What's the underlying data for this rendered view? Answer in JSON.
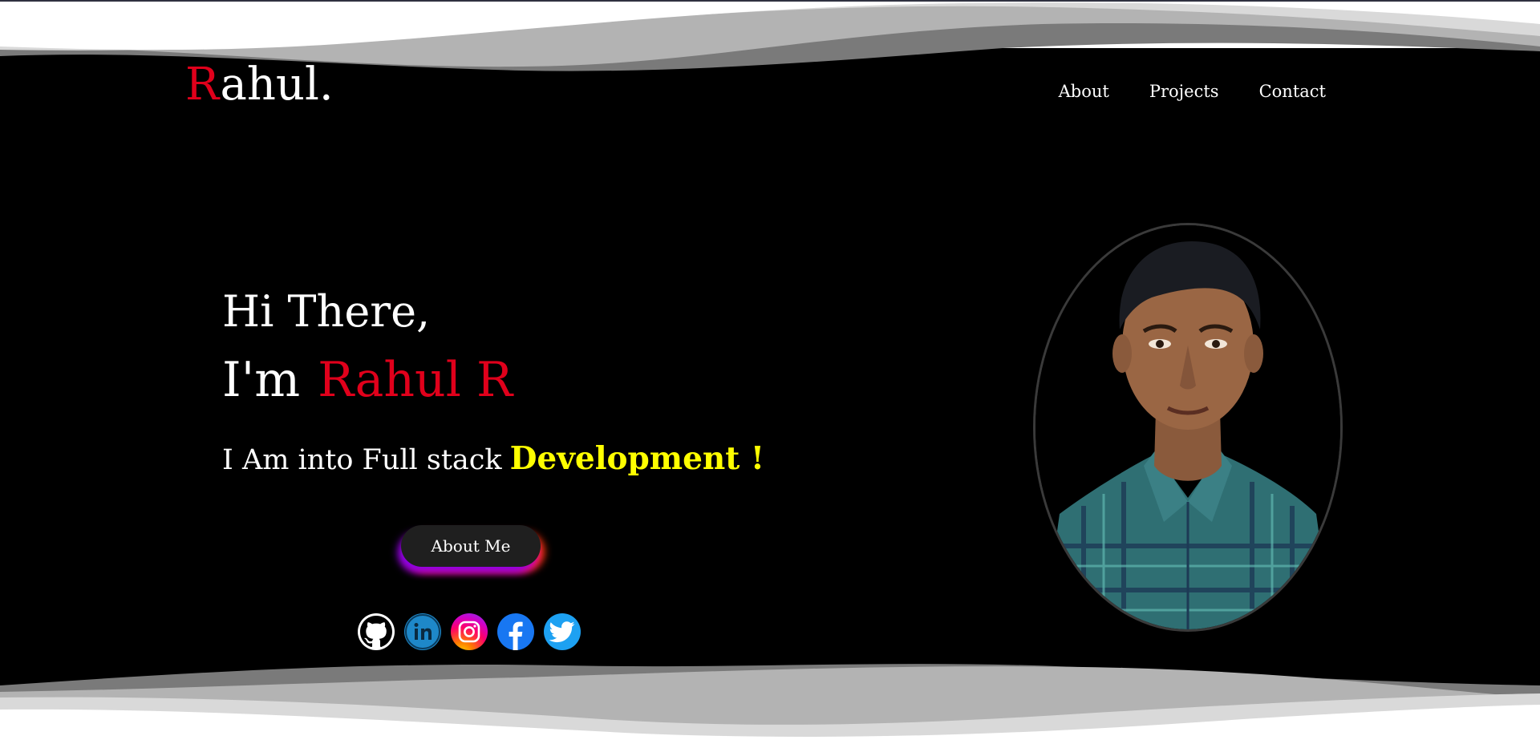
{
  "brand": {
    "initial": "R",
    "rest": "ahul."
  },
  "nav": {
    "items": [
      {
        "label": "About"
      },
      {
        "label": "Projects"
      },
      {
        "label": "Contact"
      }
    ]
  },
  "hero": {
    "greeting": "Hi There,",
    "intro_prefix": "I'm",
    "name": "Rahul R",
    "tagline_prefix": "I Am into Full stack",
    "tagline_highlight": "Development !",
    "button_label": "About Me"
  },
  "socials": [
    {
      "name": "github-icon"
    },
    {
      "name": "linkedin-icon"
    },
    {
      "name": "instagram-icon"
    },
    {
      "name": "facebook-icon"
    },
    {
      "name": "twitter-icon"
    }
  ],
  "colors": {
    "background": "#000000",
    "accent_red": "#e0001b",
    "accent_yellow": "#ffff00",
    "text": "#ffffff"
  }
}
